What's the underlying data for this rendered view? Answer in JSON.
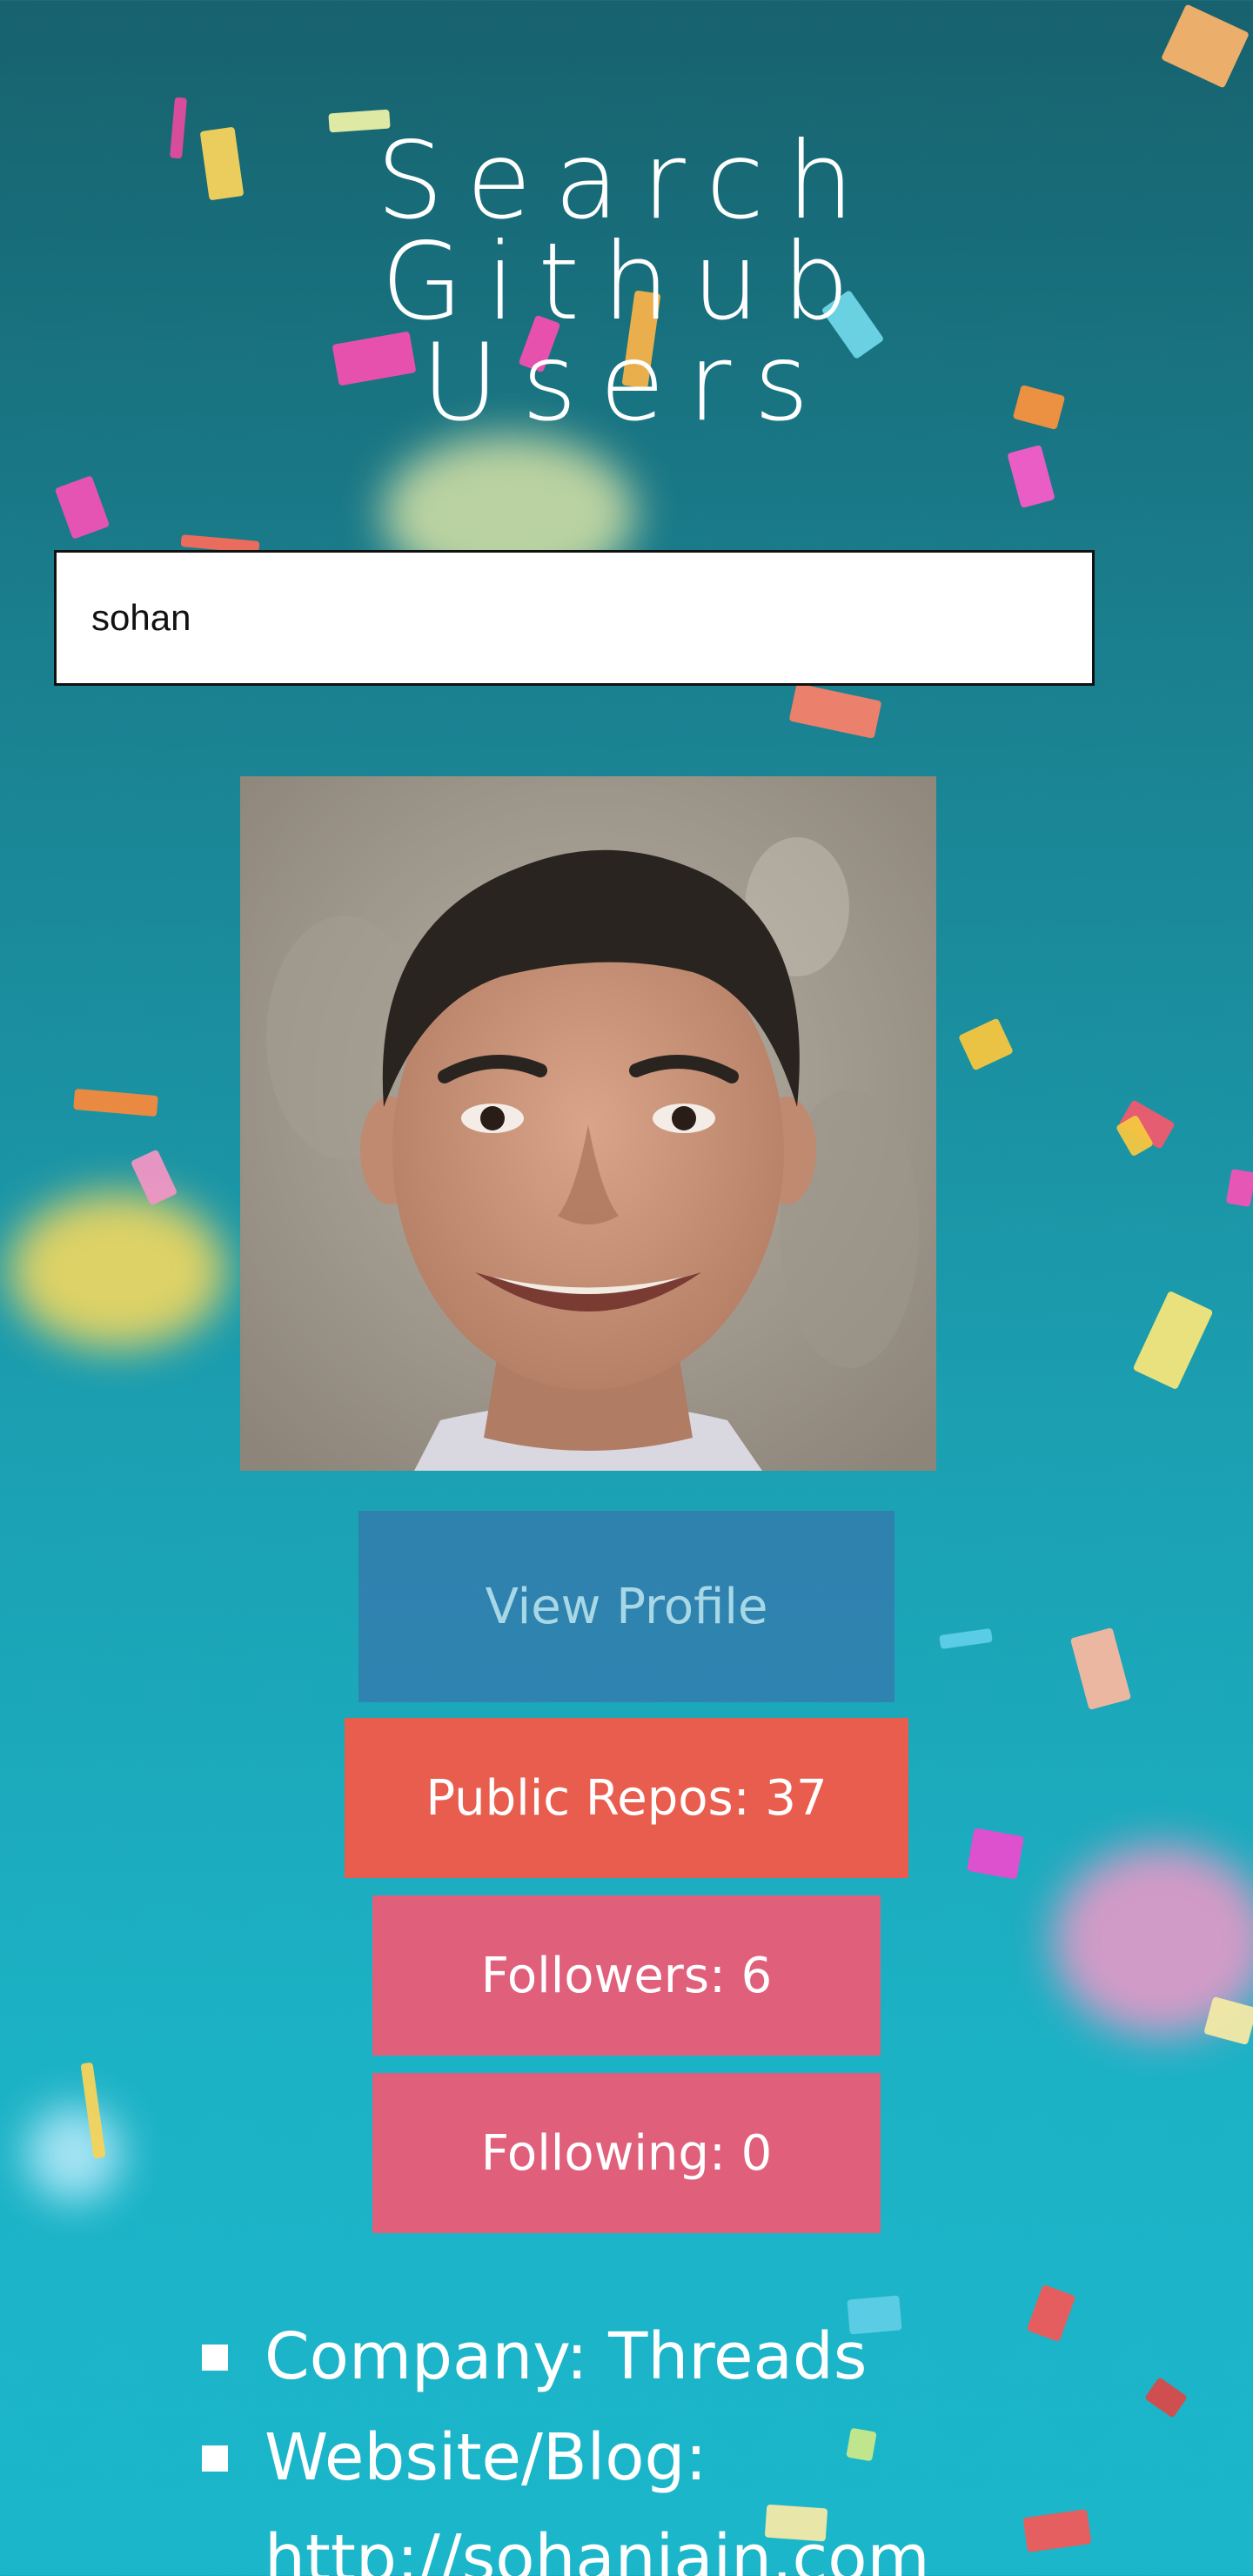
{
  "header": {
    "title_lines": [
      "Search",
      "Github",
      "Users"
    ]
  },
  "search": {
    "value": "sohan"
  },
  "profile": {
    "view_profile_label": "View Profile",
    "public_repos_label": "Public Repos: 37",
    "followers_label": "Followers: 6",
    "following_label": "Following: 0",
    "details": [
      {
        "text": "Company: Threads"
      },
      {
        "text": "Website/Blog: http://sohanjain.com"
      }
    ]
  },
  "colors": {
    "background_top": "#17626e",
    "background_bottom": "#1bb6ca",
    "view_profile_bg": "#3c6eaa",
    "public_repos_bg": "#e85d4d",
    "followers_bg": "#e0607c",
    "following_bg": "#e0607c"
  }
}
